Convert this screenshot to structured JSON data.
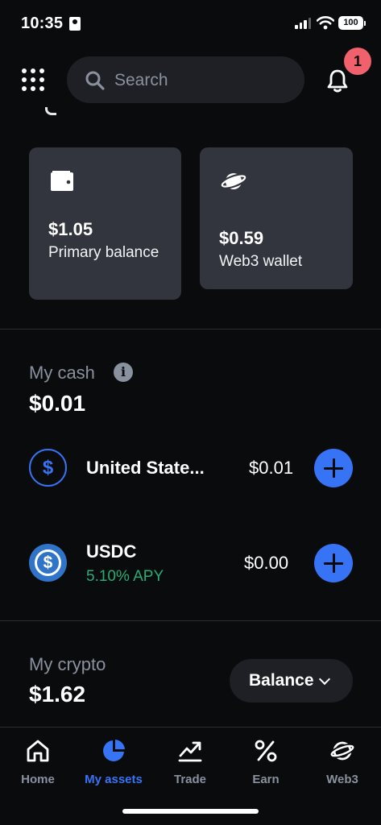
{
  "status_bar": {
    "time": "10:35",
    "battery": "100"
  },
  "header": {
    "search_placeholder": "Search",
    "notification_count": "1"
  },
  "balances": {
    "primary": {
      "value": "$1.05",
      "label": "Primary balance"
    },
    "web3": {
      "value": "$0.59",
      "label": "Web3 wallet"
    }
  },
  "my_cash": {
    "title": "My cash",
    "total": "$0.01",
    "assets": [
      {
        "name": "United State...",
        "amount": "$0.01",
        "icon": "usd-icon"
      },
      {
        "name": "USDC",
        "subtitle": "5.10% APY",
        "amount": "$0.00",
        "icon": "usdc-icon"
      }
    ]
  },
  "my_crypto": {
    "title": "My crypto",
    "total": "$1.62",
    "sort_button": "Balance"
  },
  "tabs": [
    {
      "label": "Home",
      "icon": "home-icon",
      "active": false
    },
    {
      "label": "My assets",
      "icon": "pie-chart-icon",
      "active": true
    },
    {
      "label": "Trade",
      "icon": "trend-icon",
      "active": false
    },
    {
      "label": "Earn",
      "icon": "percent-icon",
      "active": false
    },
    {
      "label": "Web3",
      "icon": "planet-icon",
      "active": false
    }
  ],
  "colors": {
    "background": "#0a0b0d",
    "card": "#32353d",
    "accent": "#3773f5",
    "positive": "#27ad75",
    "badge": "#f0616d",
    "muted_text": "#8a919e"
  }
}
